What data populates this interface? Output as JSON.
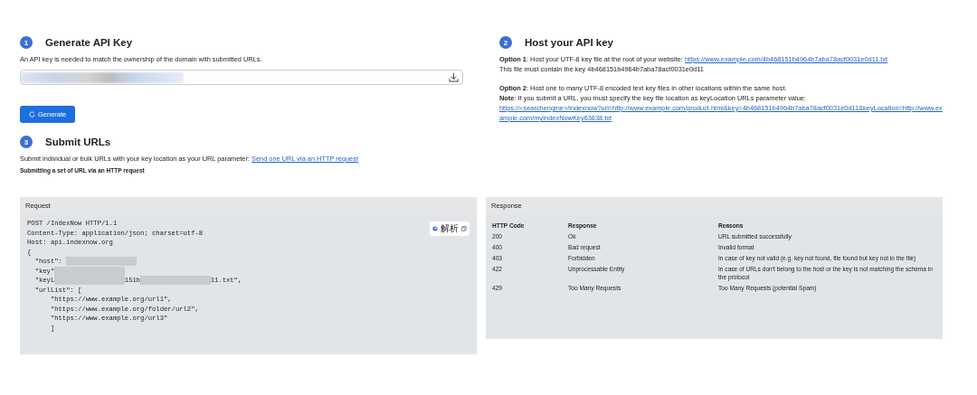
{
  "steps": [
    {
      "number": "1",
      "title": "Generate API Key",
      "description": "An API key is needed to match the ownership of the domain with submitted URLs.",
      "key_field": {
        "value_hidden": true
      },
      "button": "Generate"
    },
    {
      "number": "2",
      "title": "Host your API key",
      "option1": {
        "text": "**Option 1**: Host your UTF-8 key file at the root of your website: ",
        "link": "https://www.example.com/4b468151b4964b7aba78acf0031e0d11.txt"
      },
      "option1_note": "This file must contain the key 4b468151b4964b7aba78acf0031e0d11",
      "option2": "**Option 2**: Host one to many UTF-8 encoded text key files in other locations within the same host.",
      "note": "**Note**: If you submit a URL, you must specify the key file location as keyLocation URLs parameter value:",
      "note_link": "https://<searchengine>/indexnow?url=http://www.example.com/product.html&key=4b468151b4964b7aba78acf0031e0d11&keyLocation=http://www.example.com/myIndexNowKey63638.txt"
    },
    {
      "number": "3",
      "title": "Submit URLs",
      "description": "Submit individual or bulk URLs with your key location as your URL parameter: ",
      "link": "Send one URL via an HTTP request",
      "subheading": "Submitting a set of URL via an HTTP request"
    }
  ],
  "request": {
    "title": "Request",
    "badge": "解析",
    "lines": [
      [
        {
          "kind": "text",
          "text": "POST /IndexNow HTTP/1.1"
        }
      ],
      [
        {
          "kind": "text",
          "text": "Content-Type: application/json; charset=utf-8"
        }
      ],
      [
        {
          "kind": "text",
          "text": "Host: api.indexnow.org"
        }
      ],
      [
        {
          "kind": "text",
          "text": "{"
        }
      ],
      [
        {
          "kind": "text",
          "text": "  \"host\": "
        },
        {
          "kind": "blur"
        }
      ],
      [
        {
          "kind": "text",
          "text": "  \"key\""
        },
        {
          "kind": "blur"
        }
      ],
      [
        {
          "kind": "text",
          "text": "  \"keyL"
        },
        {
          "kind": "blur"
        },
        {
          "kind": "text",
          "text": "151b"
        },
        {
          "kind": "blur"
        },
        {
          "kind": "text",
          "text": "11.txt\","
        }
      ],
      [
        {
          "kind": "text",
          "text": "  \"urlList\": ["
        }
      ],
      [
        {
          "kind": "text",
          "text": "      \"https://www.example.org/url1\","
        }
      ],
      [
        {
          "kind": "text",
          "text": "      \"https://www.example.org/folder/url2\","
        }
      ],
      [
        {
          "kind": "text",
          "text": "      \"https://www.example.org/url3\""
        }
      ],
      [
        {
          "kind": "text",
          "text": "      ]"
        }
      ]
    ]
  },
  "response": {
    "title": "Response",
    "columns": [
      "HTTP Code",
      "Response",
      "Reasons"
    ],
    "rows": [
      [
        "200",
        "Ok",
        "URL submitted successfully"
      ],
      [
        "400",
        "Bad request",
        "Invalid format"
      ],
      [
        "403",
        "Forbidden",
        "In case of key not valid (e.g. key not found, file found but key not in the file)"
      ],
      [
        "422",
        "Unprocessable Entity",
        "In case of URLs don't belong to the host or the key is not matching the schema in the protocol"
      ],
      [
        "429",
        "Too Many Requests",
        "Too Many Requests (potential Spam)"
      ]
    ]
  }
}
